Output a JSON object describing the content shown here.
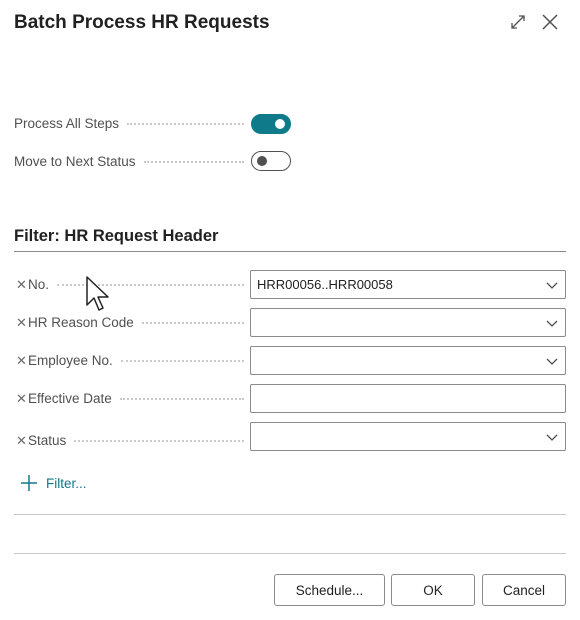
{
  "dialog": {
    "title": "Batch Process HR Requests",
    "expand_icon": "expand-icon",
    "close_icon": "close-icon"
  },
  "options": [
    {
      "label": "Process All Steps",
      "on": true
    },
    {
      "label": "Move to Next Status",
      "on": false
    }
  ],
  "filter": {
    "title": "Filter: HR Request Header",
    "rows": [
      {
        "label": "No.",
        "value": "HRR00056..HRR00058",
        "has_dropdown": true
      },
      {
        "label": "HR Reason Code",
        "value": "",
        "has_dropdown": true
      },
      {
        "label": "Employee No.",
        "value": "",
        "has_dropdown": true
      },
      {
        "label": "Effective Date",
        "value": "",
        "has_dropdown": false
      },
      {
        "label": "Status",
        "value": "",
        "has_dropdown": true
      }
    ],
    "add_label": "Filter..."
  },
  "buttons": {
    "schedule": "Schedule...",
    "ok": "OK",
    "cancel": "Cancel"
  },
  "colors": {
    "accent": "#0e7a8a",
    "text": "#212121",
    "label": "#505050"
  }
}
